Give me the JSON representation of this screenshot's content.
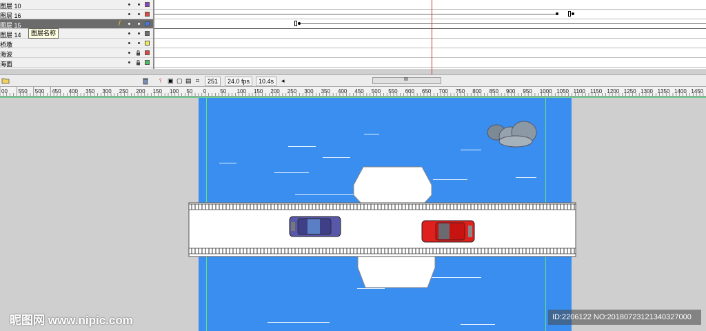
{
  "layers": [
    {
      "name": "图层 10",
      "color": "#8e3fc7",
      "locked": false,
      "selected": false
    },
    {
      "name": "图层 16",
      "color": "#e0463c",
      "locked": false,
      "selected": false
    },
    {
      "name": "图层 15",
      "color": "#3d7ae8",
      "locked": false,
      "selected": true
    },
    {
      "name": "图层 14",
      "color": "#6e6e6e",
      "locked": false,
      "selected": false
    },
    {
      "name": "桥墩",
      "color": "#f2ea55",
      "locked": false,
      "selected": false
    },
    {
      "name": "海波",
      "color": "#e0463c",
      "locked": true,
      "selected": false
    },
    {
      "name": "海面",
      "color": "#47c05a",
      "locked": true,
      "selected": false
    }
  ],
  "tooltip": "图层名称",
  "timeline": {
    "current_frame": "251",
    "frame_rate": "24.0 fps",
    "elapsed_time": "10.4s",
    "scroll_grip": "III"
  },
  "ruler_labels": [
    "00",
    "550",
    "500",
    "450",
    "400",
    "350",
    "300",
    "250",
    "200",
    "150",
    "100",
    "50",
    "0",
    "50",
    "100",
    "150",
    "200",
    "250",
    "300",
    "350",
    "400",
    "450",
    "500",
    "550",
    "600",
    "650",
    "700",
    "750",
    "800",
    "850",
    "900",
    "950",
    "1000",
    "1050",
    "1100",
    "1150",
    "1200",
    "1250",
    "1300",
    "1350",
    "1400",
    "1450"
  ],
  "watermark": "昵图网 www.nipic.com",
  "image_id": "ID:2206122 NO:20180723121340327000",
  "colors": {
    "water": "#3a8ef0",
    "stage_bg": "#cfcfcf",
    "car_blue": "#5858a8",
    "car_red": "#e0201c"
  }
}
